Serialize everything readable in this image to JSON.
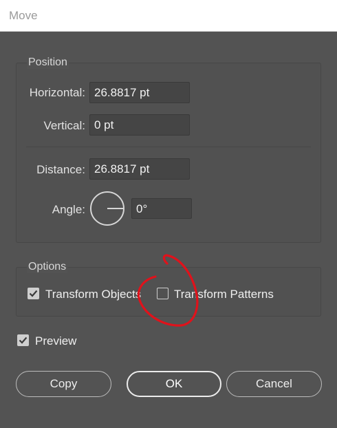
{
  "window": {
    "title": "Move"
  },
  "position": {
    "group_label": "Position",
    "horizontal_label": "Horizontal:",
    "horizontal_value": "26.8817 pt",
    "vertical_label": "Vertical:",
    "vertical_value": "0 pt",
    "distance_label": "Distance:",
    "distance_value": "26.8817 pt",
    "angle_label": "Angle:",
    "angle_value": "0°"
  },
  "options": {
    "group_label": "Options",
    "transform_objects_label": "Transform Objects",
    "transform_objects_checked": true,
    "transform_patterns_label": "Transform Patterns",
    "transform_patterns_checked": false
  },
  "preview": {
    "label": "Preview",
    "checked": true
  },
  "buttons": {
    "copy": "Copy",
    "ok": "OK",
    "cancel": "Cancel"
  },
  "colors": {
    "background": "#535353",
    "annotation": "#e0121b"
  }
}
